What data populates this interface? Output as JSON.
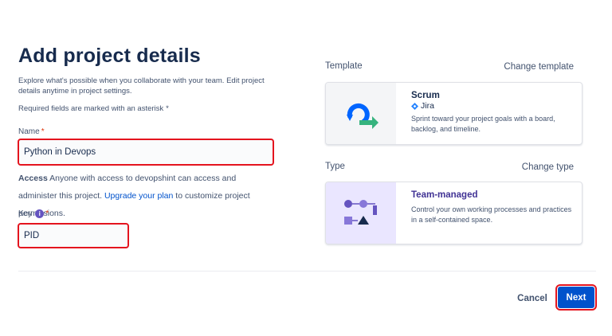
{
  "page": {
    "title": "Add project details",
    "intro": "Explore what's possible when you collaborate with your team. Edit project details anytime in project settings.",
    "required_note": "Required fields are marked with an asterisk",
    "asterisk": "*"
  },
  "form": {
    "name": {
      "label": "Name",
      "value": "Python in Devops"
    },
    "access": {
      "label": "Access",
      "text": "Anyone with access to devopshint can access and administer this project.",
      "link": "Upgrade your plan",
      "suffix": "to customize project permissions."
    },
    "key": {
      "label": "Key",
      "info": "i",
      "value": "PID"
    }
  },
  "template": {
    "label": "Template",
    "change_label": "Change template",
    "name": "Scrum",
    "product": "Jira",
    "description": "Sprint toward your project goals with a board, backlog, and timeline."
  },
  "type": {
    "label": "Type",
    "change_label": "Change type",
    "name": "Team-managed",
    "description": "Control your own working processes and practices in a self-contained space."
  },
  "footer": {
    "cancel_label": "Cancel",
    "next_label": "Next"
  },
  "colors": {
    "accent": "#0052cc",
    "highlight": "#e4141e",
    "type_accent": "#6554c0"
  }
}
